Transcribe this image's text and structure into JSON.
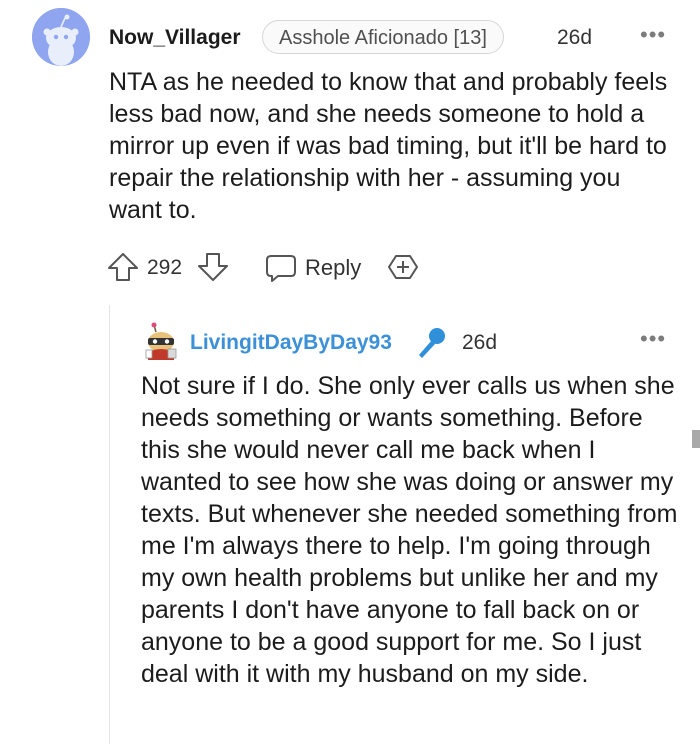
{
  "comment": {
    "username": "Now_Villager",
    "flair": "Asshole Aficionado [13]",
    "age": "26d",
    "more": "•••",
    "body": "NTA as he needed to know that and probably feels less bad now, and she needs someone to hold a mirror up even if was bad timing, but it'll be hard to repair the relationship with her - assuming you want to.",
    "score": "292",
    "reply_label": "Reply"
  },
  "reply": {
    "username": "LivingitDayByDay93",
    "age": "26d",
    "more": "•••",
    "body": "Not sure if I do. She only ever calls us when she needs something or wants something. Before this she would never call me back when I wanted to see how she was doing or answer my texts. But whenever she needed something from me I'm always there to help. I'm going through my own health problems but unlike her and my parents I don't have anyone to fall back on or anyone to be a good support for me. So I just deal with it with my husband on my side."
  },
  "colors": {
    "avatar_bg": "#8fa5f0",
    "op_username": "#3b90d7",
    "mic": "#2f8fd8"
  },
  "icons": [
    "snoo-avatar",
    "upvote-icon",
    "downvote-icon",
    "comment-bubble-icon",
    "award-icon",
    "custom-avatar",
    "microphone-icon",
    "more-options-icon"
  ]
}
